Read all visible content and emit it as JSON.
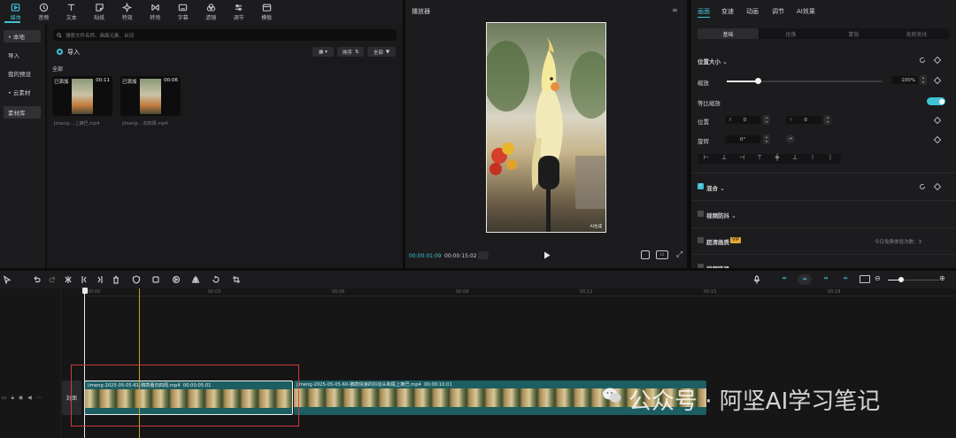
{
  "toolbar": {
    "items": [
      {
        "label": "媒体",
        "icon": "media-icon"
      },
      {
        "label": "音频",
        "icon": "audio-icon"
      },
      {
        "label": "文本",
        "icon": "text-icon"
      },
      {
        "label": "贴纸",
        "icon": "sticker-icon"
      },
      {
        "label": "特效",
        "icon": "effect-icon"
      },
      {
        "label": "转场",
        "icon": "transition-icon"
      },
      {
        "label": "字幕",
        "icon": "subtitle-icon"
      },
      {
        "label": "滤镜",
        "icon": "filter-icon"
      },
      {
        "label": "调节",
        "icon": "adjust-icon"
      },
      {
        "label": "模板",
        "icon": "template-icon"
      }
    ]
  },
  "media_sidebar": {
    "items": [
      "• 本地",
      "导入",
      "我的预设",
      "• 云素材",
      "素材库"
    ]
  },
  "media": {
    "search_placeholder": "搜索文件名称、画面元素、台词",
    "import_label": "导入",
    "sort_label": "排序",
    "filter_label": "全部",
    "section_label": "全部",
    "thumbs": [
      {
        "tag": "已添加",
        "duration": "00:11",
        "name": "jimeng-...上摘巴.mp4"
      },
      {
        "tag": "已添加",
        "duration": "00:06",
        "name": "jimeng-...向四周.mp4"
      }
    ]
  },
  "player": {
    "title": "播放器",
    "current_time": "00:00:01:09",
    "total_time": "00:00:15:02",
    "ratio_label": "比例",
    "watermark": "AI生成"
  },
  "props": {
    "tabs": [
      "画面",
      "变速",
      "动画",
      "调节",
      "AI效果"
    ],
    "subtabs": [
      "基础",
      "抠像",
      "蒙版",
      "美颜美体"
    ],
    "position_size": "位置大小",
    "scale_label": "缩放",
    "scale_value": "100%",
    "scale_fraction": 0.2,
    "uniform_scale": "等比缩放",
    "position_label": "位置",
    "x_label": "X",
    "x_value": "0",
    "y_label": "Y",
    "y_value": "0",
    "rotate_label": "旋转",
    "rotate_value": "0°",
    "blend_label": "混合",
    "stabilize_label": "视频防抖",
    "superres_label": "超清画质",
    "superres_badge": "VIP",
    "superres_note": "今日免费体验次数：3",
    "last_label": "视频降噪"
  },
  "timeline": {
    "ruler": [
      "00:00",
      "00:03",
      "00:06",
      "00:09",
      "00:12",
      "00:15",
      "00:18"
    ],
    "cover_label": "封面",
    "clips": [
      {
        "name": "jimeng-2025-05-05-61-鹦鹉看向四周.mp4",
        "duration": "00:00:05:01"
      },
      {
        "name": "jimeng-2025-05-05-60-鹦鹉快速的抖动头和尾上摘巴.mp4",
        "duration": "00:00:10:01"
      }
    ]
  },
  "overlay": {
    "watermark": "公众号 · 阿坚AI学习笔记"
  },
  "colors": {
    "accent": "#3fc2d6",
    "clip": "#1c5e62",
    "selection_box": "#d23a3a",
    "playhead": "#c9a227"
  }
}
